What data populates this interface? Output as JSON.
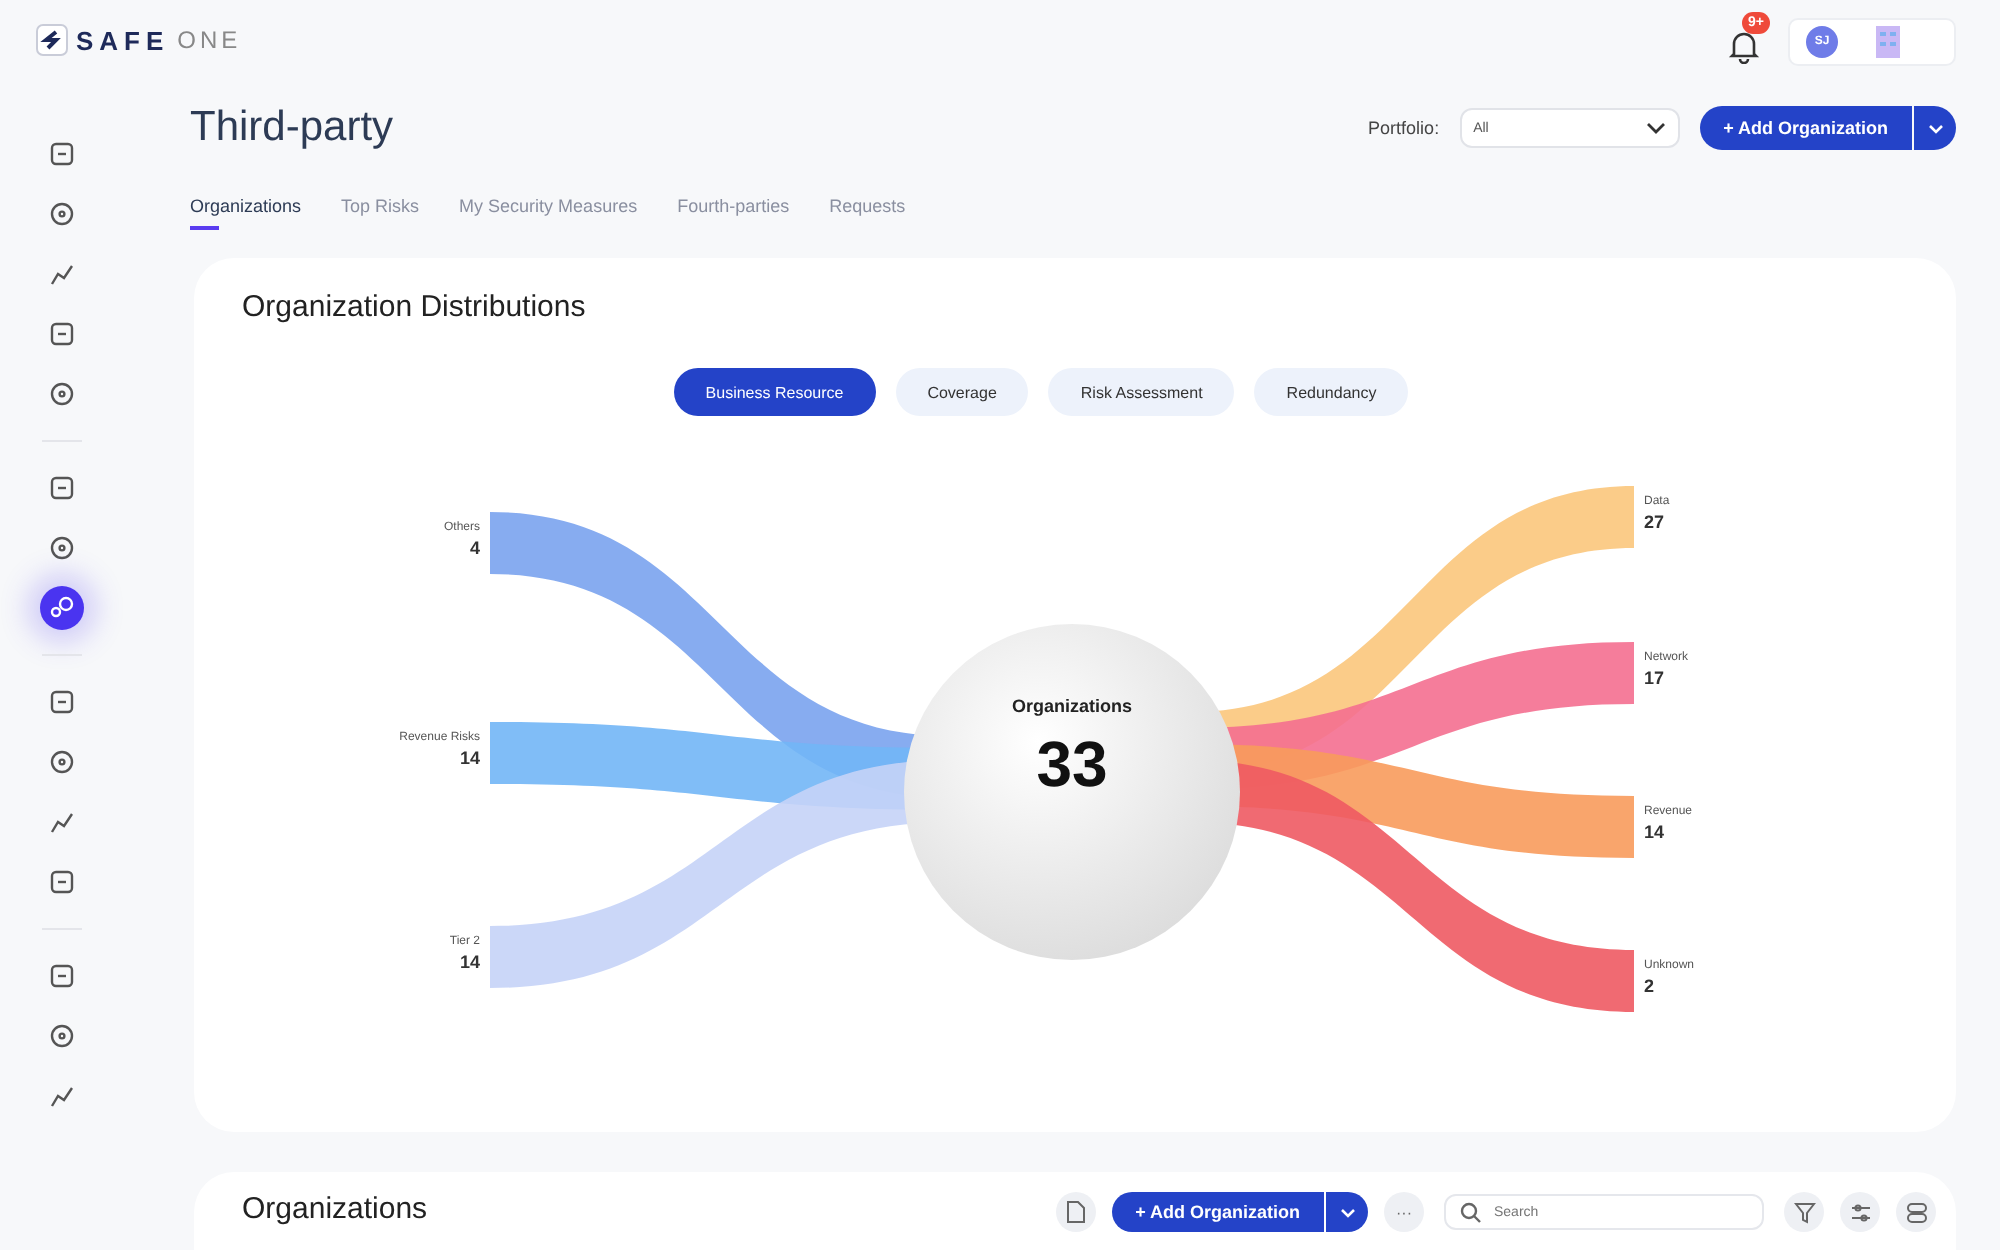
{
  "logo": {
    "brand": "SAFE",
    "suffix": "ONE"
  },
  "notifications": {
    "badge": "9+"
  },
  "user": {
    "initials": "SJ"
  },
  "sidebar": {
    "groups": [
      [
        {
          "selected": false
        },
        {
          "selected": false
        },
        {
          "selected": false
        },
        {
          "selected": false
        },
        {
          "selected": false
        }
      ],
      [
        {
          "selected": false
        },
        {
          "selected": false
        },
        {
          "selected": true
        }
      ],
      [
        {
          "selected": false
        },
        {
          "selected": false
        },
        {
          "selected": false
        },
        {
          "selected": false
        }
      ],
      [
        {
          "selected": false
        },
        {
          "selected": false
        },
        {
          "selected": false
        }
      ]
    ]
  },
  "page": {
    "title": "Third-party",
    "portfolio_label": "Portfolio:",
    "portfolio_value": "All",
    "add_button": "+ Add Organization"
  },
  "tabs": [
    {
      "label": "Organizations",
      "selected": true
    },
    {
      "label": "Top Risks",
      "selected": false
    },
    {
      "label": "My Security Measures",
      "selected": false
    },
    {
      "label": "Fourth-parties",
      "selected": false
    },
    {
      "label": "Requests",
      "selected": false
    }
  ],
  "distribution": {
    "title": "Organization Distributions",
    "filters": [
      {
        "label": "Business Resource",
        "selected": true
      },
      {
        "label": "Coverage",
        "selected": false
      },
      {
        "label": "Risk Assessment",
        "selected": false
      },
      {
        "label": "Redundancy",
        "selected": false
      }
    ],
    "center": {
      "label": "Organizations",
      "value": "33"
    },
    "sources": [
      {
        "label": "Others",
        "value": "4",
        "color": "#7aa3ee"
      },
      {
        "label": "Revenue Risks",
        "value": "14",
        "color": "#72b6f6"
      },
      {
        "label": "Tier 2",
        "value": "14",
        "color": "#c5d3f7"
      }
    ],
    "targets": [
      {
        "label": "Data",
        "value": "27",
        "color": "#fbc67c"
      },
      {
        "label": "Network",
        "value": "17",
        "color": "#f46f90"
      },
      {
        "label": "Revenue",
        "value": "14",
        "color": "#f89b5c"
      },
      {
        "label": "Unknown",
        "value": "2",
        "color": "#ee5a63"
      }
    ]
  },
  "organizations": {
    "title": "Organizations",
    "add_button": "+ Add Organization",
    "more": "···",
    "search_placeholder": "Search"
  }
}
